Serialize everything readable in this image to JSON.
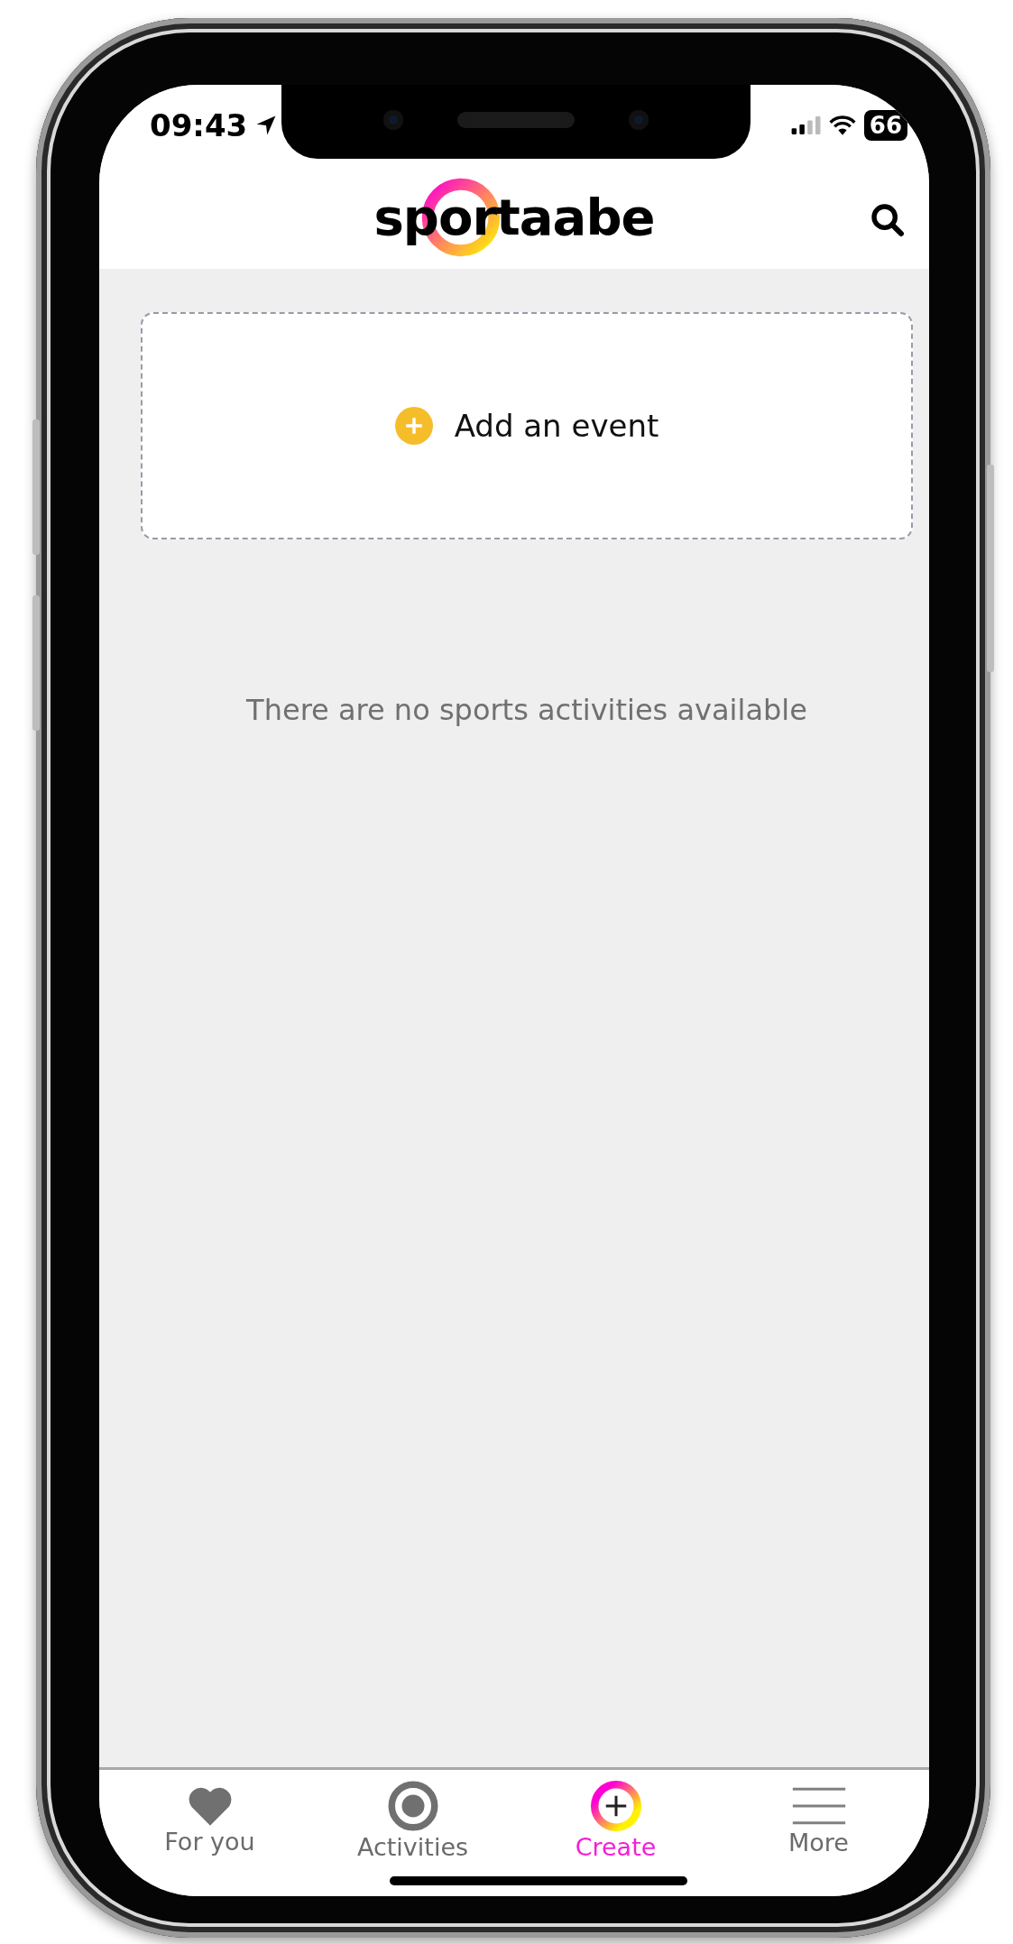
{
  "status_bar": {
    "time": "09:43",
    "battery": "66"
  },
  "header": {
    "logo": "sportaabe"
  },
  "add_event": {
    "label": "Add an event"
  },
  "empty_message": "There are no sports activities available",
  "tabs": [
    {
      "label": "For you",
      "kind": "heart",
      "selected": false
    },
    {
      "label": "Activities",
      "kind": "target",
      "selected": false
    },
    {
      "label": "Create",
      "kind": "create",
      "selected": true
    },
    {
      "label": "More",
      "kind": "menu",
      "selected": false
    }
  ]
}
